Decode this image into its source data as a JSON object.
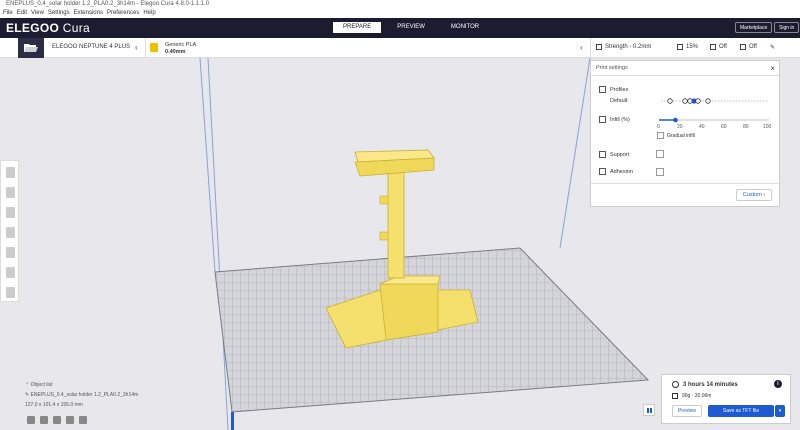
{
  "window": {
    "title": "ENEPLUS_0.4_solar holder 1.2_PLA0.2_3h14m - Elegoo Cura 4.8.0-1.1.1.0"
  },
  "menu": [
    "File",
    "Edit",
    "View",
    "Settings",
    "Extensions",
    "Preferences",
    "Help"
  ],
  "header": {
    "brand": "ELEGOO",
    "product": "Cura",
    "stages": [
      "PREPARE",
      "PREVIEW",
      "MONITOR"
    ],
    "active_stage": "PREPARE",
    "marketplace": "Marketplace",
    "signin": "Sign in"
  },
  "toolbar": {
    "printer": "ELEGOO NEPTUNE 4 PLUS",
    "material": "Generic PLA",
    "nozzle": "0.40mm",
    "profile": "Strength - 0.2mm",
    "infill": "15%",
    "support": "Off",
    "adhesion": "Off"
  },
  "print_settings": {
    "title": "Print settings",
    "profiles_label": "Profiles",
    "profile_value": "Default",
    "infill_label": "Infill (%)",
    "infill_ticks": [
      "0",
      "20",
      "40",
      "60",
      "80",
      "100"
    ],
    "infill_value": 15,
    "gradual_infill": "Gradual infill",
    "support_label": "Support",
    "adhesion_label": "Adhesion",
    "custom_button": "Custom"
  },
  "object_list": {
    "title": "Object list",
    "filename": "ENEPLUS_0.4_solar holder 1.2_PLA0.2_3h14m",
    "dimensions": "127.0 x 101.4 x 155.0 mm"
  },
  "estimate": {
    "time": "3 hours 14 minutes",
    "material": "90g · 30.06m",
    "preview_button": "Preview",
    "save_button": "Save as TFT file"
  },
  "colors": {
    "header_bg": "#1c1c30",
    "accent": "#1f5bd0",
    "model_yellow": "#f5e06e",
    "viewport_bg": "#e8e8ec"
  }
}
